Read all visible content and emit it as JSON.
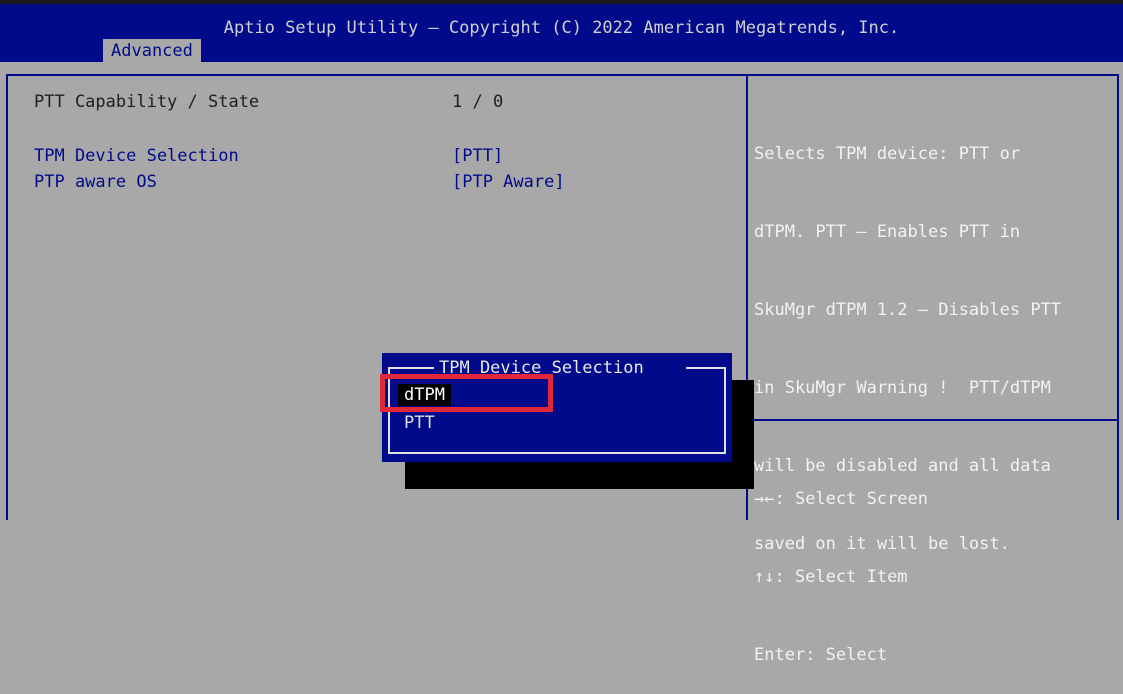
{
  "header": {
    "title": "Aptio Setup Utility – Copyright (C) 2022 American Megatrends, Inc.",
    "tab": "Advanced"
  },
  "settings": [
    {
      "label": "PTT Capability / State",
      "value": "1 / 0"
    },
    {
      "label": "TPM Device Selection",
      "value": "[PTT]"
    },
    {
      "label": "PTP aware OS",
      "value": "[PTP Aware]"
    }
  ],
  "help": {
    "lines": [
      "Selects TPM device: PTT or",
      "dTPM. PTT – Enables PTT in",
      "SkuMgr dTPM 1.2 – Disables PTT",
      "in SkuMgr Warning !  PTT/dTPM",
      "will be disabled and all data",
      "saved on it will be lost."
    ]
  },
  "keys": [
    {
      "key": "→←",
      "action": ": Select Screen"
    },
    {
      "key": "↑↓",
      "action": ": Select Item"
    },
    {
      "key": "Enter",
      "action": ": Select"
    }
  ],
  "popup": {
    "title": "TPM Device Selection",
    "options": [
      "dTPM",
      "PTT"
    ],
    "selected": "dTPM"
  },
  "colors": {
    "bios_blue": "#000a8a",
    "panel_gray": "#a8a8a8",
    "highlight_red": "#e0283a"
  }
}
